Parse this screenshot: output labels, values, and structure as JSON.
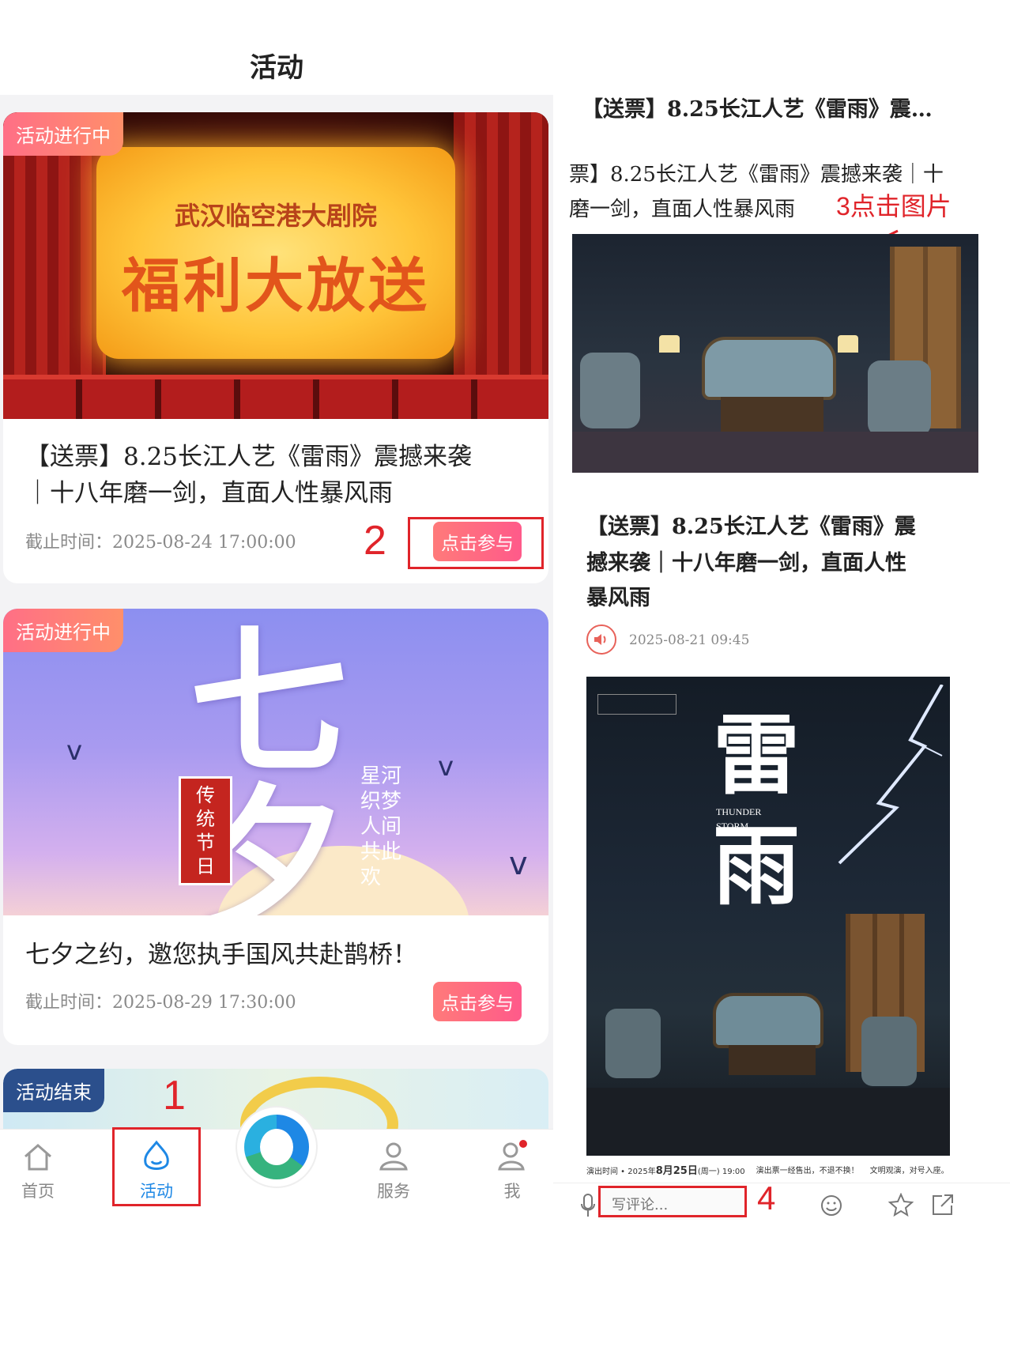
{
  "left": {
    "page_title": "活动",
    "cards": [
      {
        "status": "活动进行中",
        "banner_subtitle": "武汉临空港大剧院",
        "banner_title": "福利大放送",
        "title_line1": "【送票】8.25长江人艺《雷雨》震撼来袭",
        "title_line2": "｜十八年磨一剑，直面人性暴风雨",
        "deadline": "截止时间：2025-08-24 17:00:00",
        "button": "点击参与"
      },
      {
        "status": "活动进行中",
        "banner_big": "七夕",
        "banner_tag": "传统节日",
        "banner_poem": "星河织梦 人间共此欢",
        "title_line1": "七夕之约，邀您执手国风共赴鹊桥！",
        "deadline": "截止时间：2025-08-29 17:30:00",
        "button": "点击参与"
      },
      {
        "status": "活动结束"
      }
    ],
    "nav": [
      {
        "label": "首页",
        "icon": "home-icon"
      },
      {
        "label": "活动",
        "icon": "activity-icon",
        "active": true
      },
      {
        "label": "",
        "icon": "app-logo-icon"
      },
      {
        "label": "服务",
        "icon": "service-icon"
      },
      {
        "label": "我",
        "icon": "profile-icon"
      }
    ]
  },
  "steps": [
    "1",
    "2",
    "3点击图片",
    "4"
  ],
  "right": {
    "top_title": "【送票】8.25长江人艺《雷雨》震…",
    "preview_line1": "票】8.25长江人艺《雷雨》震撼来袭｜十",
    "preview_line2": "磨一剑，直面人性暴风雨",
    "article_title": "【送票】8.25长江人艺《雷雨》震撼来袭｜十八年磨一剑，直面人性暴风雨",
    "article_title_l1": "【送票】8.25长江人艺《雷雨》震",
    "article_title_l2": "撼来袭｜十八年磨一剑，直面人性",
    "article_title_l3": "暴风雨",
    "date": "2025-08-21 09:45",
    "poster": {
      "title": "雷雨",
      "english_1": "THUNDER",
      "english_2": "STORM",
      "showtime_label": "演出时间 • 2025年",
      "showtime_date": "8月25日",
      "showtime_rest": "(周一) 19:00",
      "notice1": "演出票一经售出，不退不换！",
      "notice2": "文明观演，对号入座。"
    },
    "comment_placeholder": "写评论..."
  },
  "colors": {
    "accent_red": "#e0242a",
    "badge_live": "#ff6f86",
    "badge_ended": "#2b4f8c",
    "nav_active": "#1e88e5"
  }
}
